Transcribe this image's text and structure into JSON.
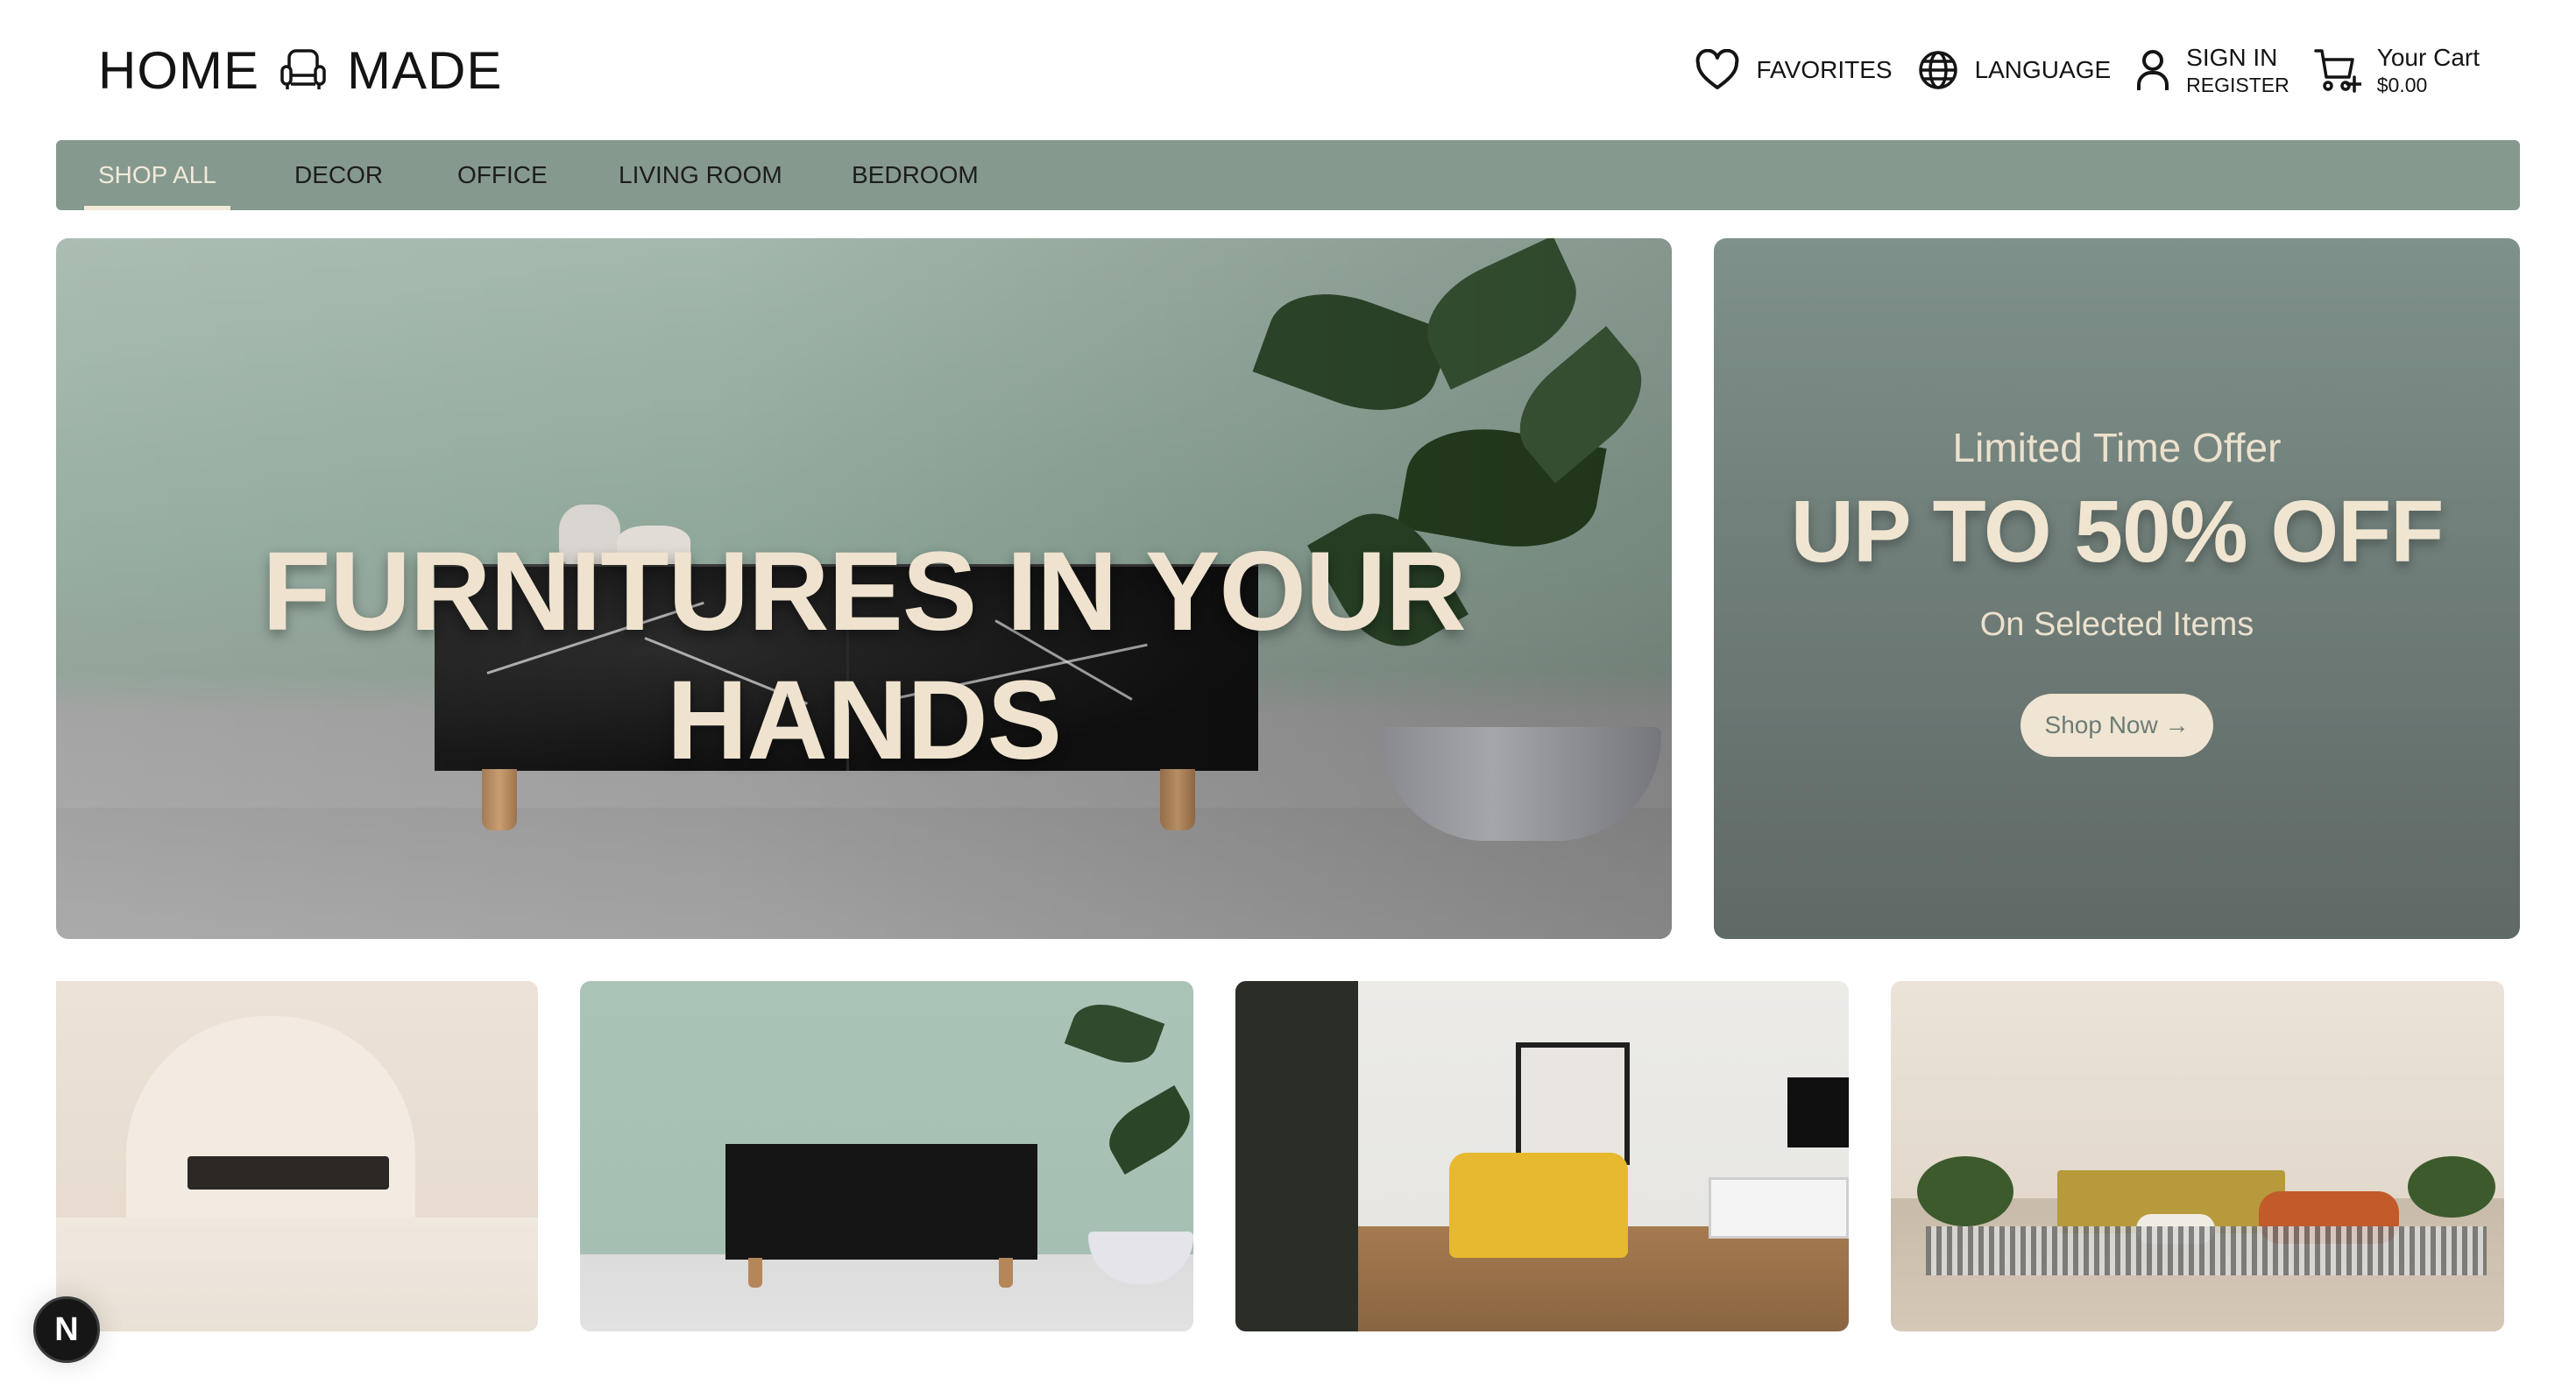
{
  "brand": {
    "word1": "HOME",
    "word2": "MADE",
    "icon": "armchair-icon"
  },
  "topnav": {
    "favorites": {
      "label": "FAVORITES",
      "icon": "heart-icon"
    },
    "language": {
      "label": "LANGUAGE",
      "icon": "globe-icon"
    },
    "account": {
      "sign_in": "SIGN IN",
      "register": "REGISTER",
      "icon": "user-icon"
    },
    "cart": {
      "label": "Your Cart",
      "total": "$0.00",
      "icon": "cart-add-icon"
    }
  },
  "categories": [
    {
      "label": "SHOP ALL",
      "active": true
    },
    {
      "label": "DECOR",
      "active": false
    },
    {
      "label": "OFFICE",
      "active": false
    },
    {
      "label": "LIVING ROOM",
      "active": false
    },
    {
      "label": "BEDROOM",
      "active": false
    }
  ],
  "hero": {
    "title": "FURNITURES IN YOUR HANDS"
  },
  "offer": {
    "kicker": "Limited Time Offer",
    "headline": "UP TO 50% OFF",
    "subtitle": "On Selected Items",
    "cta": "Shop Now →"
  },
  "dev_badge": {
    "label": "N"
  },
  "colors": {
    "nav_bar": "#86998f",
    "cream": "#efe5d1",
    "offer_bg": "#6d7a76"
  }
}
